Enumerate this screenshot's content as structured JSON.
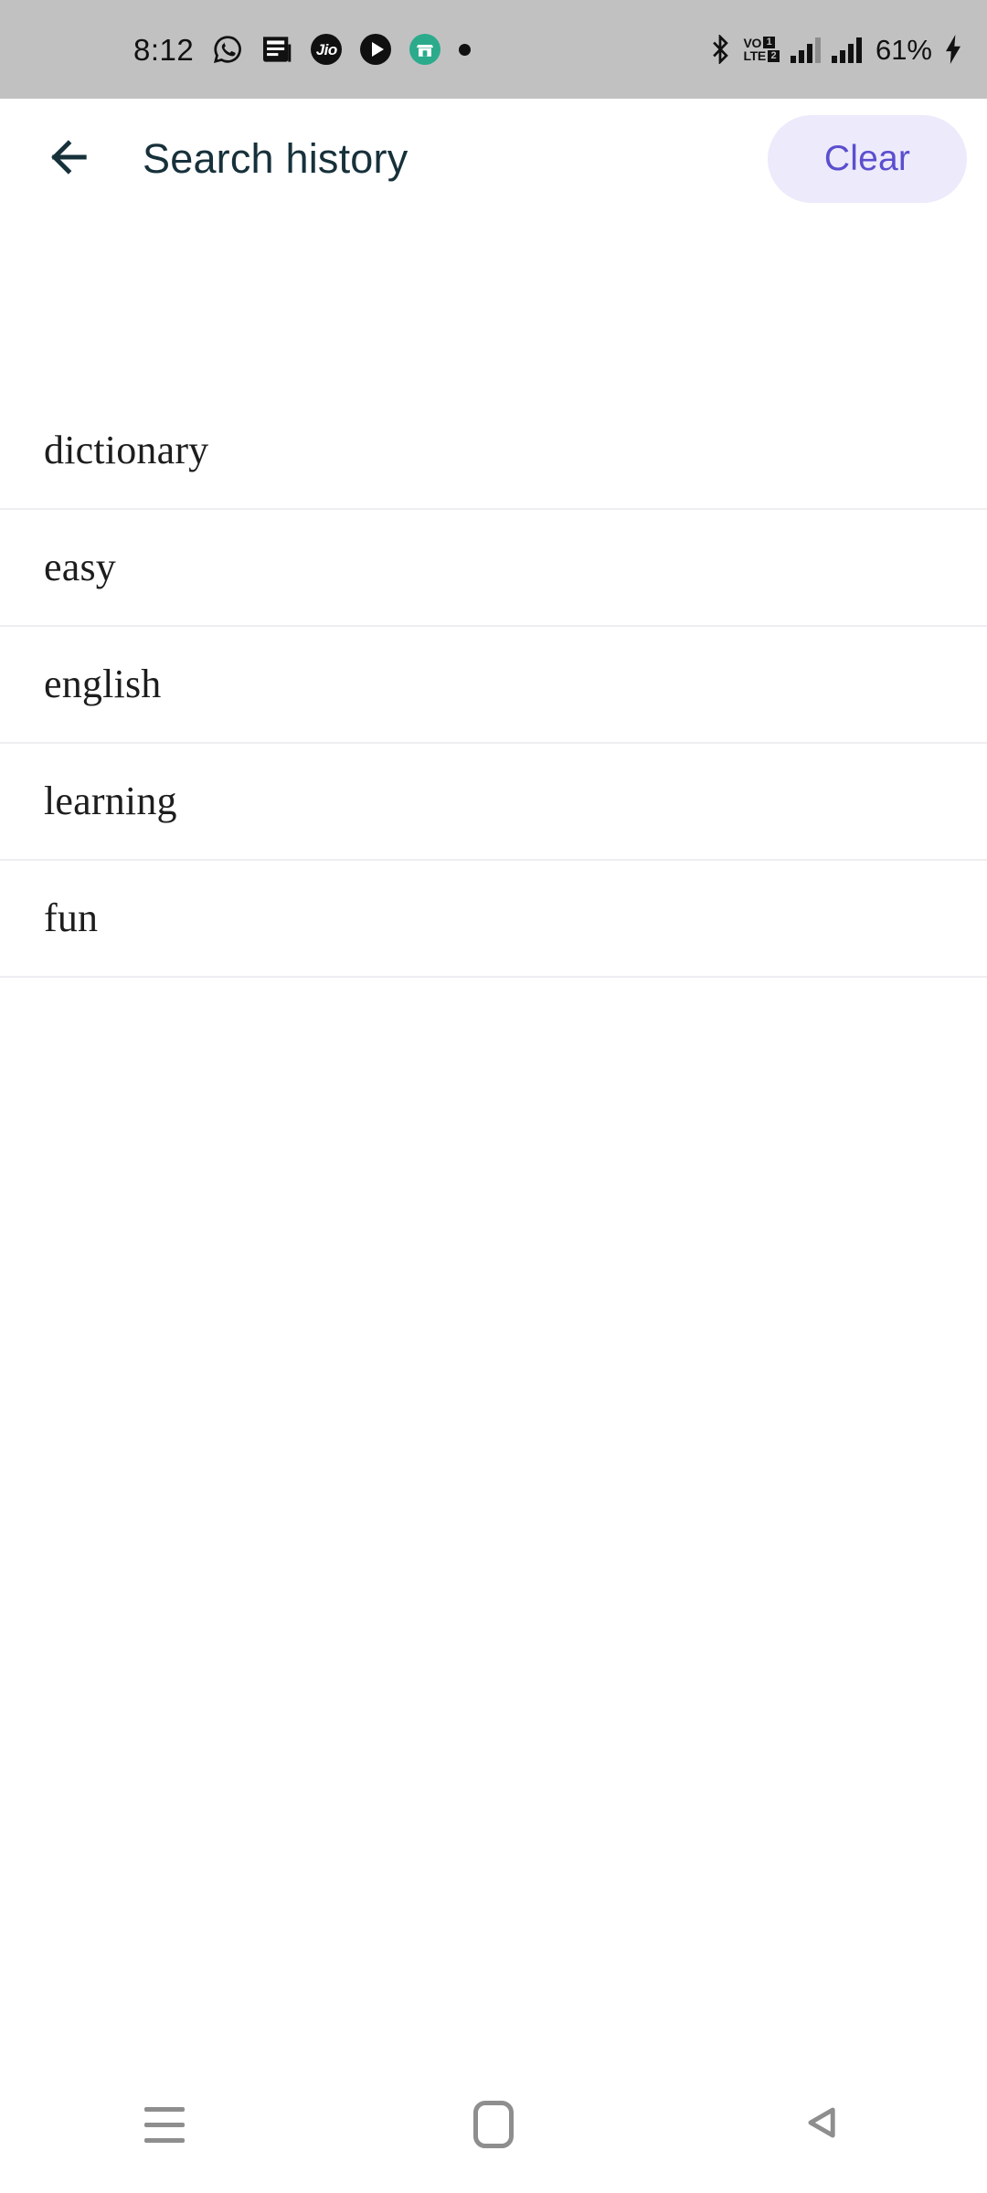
{
  "status_bar": {
    "time": "8:12",
    "battery_percent": "61%",
    "volte_top": "VO",
    "volte_bottom": "LTE",
    "sim1": "1",
    "sim2": "2",
    "jio_label": "Jio",
    "icons": [
      "whatsapp-icon",
      "news-icon",
      "jio-icon",
      "play-icon",
      "shop-icon",
      "more-notifications-dot-icon",
      "bluetooth-icon",
      "volte-indicator",
      "signal-bars-sim1-icon",
      "signal-bars-sim2-icon",
      "charging-bolt-icon"
    ],
    "background_color": "#c1c1c1"
  },
  "app_bar": {
    "title": "Search history",
    "back_icon": "back-arrow-icon",
    "clear_label": "Clear",
    "title_color": "#17313b",
    "clear_bg_color": "#edeafb",
    "clear_text_color": "#5b4fcf"
  },
  "history": {
    "items": [
      {
        "label": "dictionary"
      },
      {
        "label": "easy"
      },
      {
        "label": "english"
      },
      {
        "label": "learning"
      },
      {
        "label": "fun"
      }
    ]
  },
  "nav_bar": {
    "recents_label": "recents-icon",
    "home_label": "home-icon",
    "back_label": "back-icon",
    "icon_color": "#8e8e8e"
  }
}
